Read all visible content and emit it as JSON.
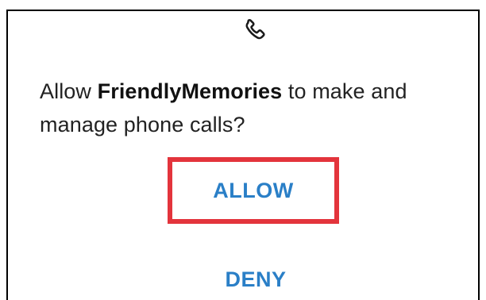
{
  "dialog": {
    "icon": "phone-icon",
    "message": {
      "prefix": "Allow ",
      "app_name": "FriendlyMemories",
      "suffix_line1": " to make and",
      "line2": "manage phone calls?"
    },
    "allow_label": "ALLOW",
    "deny_label": "DENY"
  },
  "colors": {
    "button_text": "#2a7fc7",
    "highlight_box": "#e3343c",
    "message_text": "#222222"
  }
}
